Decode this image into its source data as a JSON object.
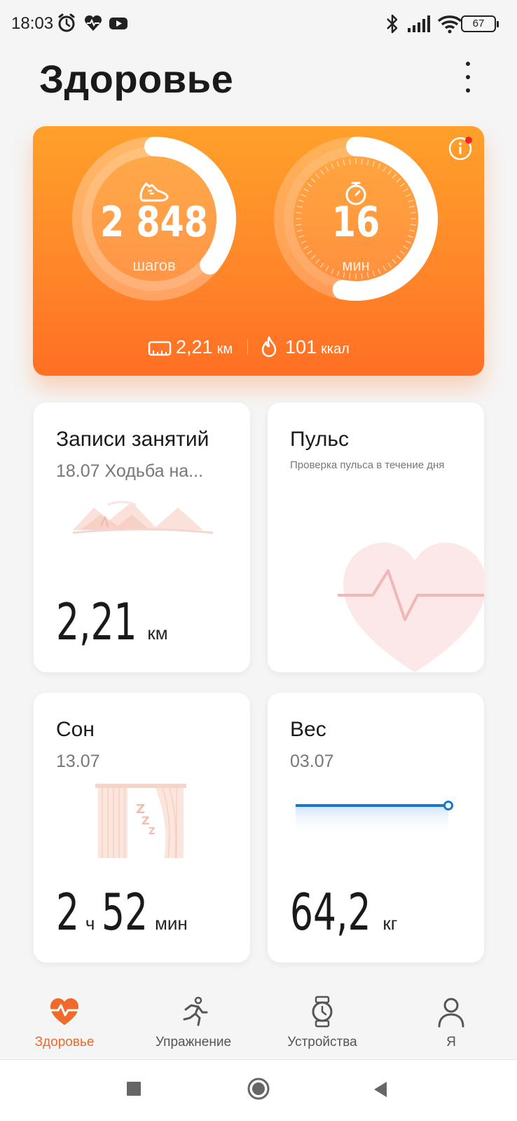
{
  "status_bar": {
    "time": "18:03",
    "left_icons": [
      "alarm-icon",
      "heart-rate-icon",
      "youtube-icon"
    ],
    "right_icons": [
      "bluetooth-icon",
      "signal-icon",
      "wifi-icon"
    ],
    "battery": "67"
  },
  "header": {
    "title": "Здоровье",
    "menu_icon": "more-vertical-icon"
  },
  "activity": {
    "steps_value": "2 848",
    "steps_unit": "шагов",
    "steps_progress": 0.36,
    "minutes_value": "16",
    "minutes_unit": "мин",
    "minutes_progress": 0.53,
    "distance_value": "2,21",
    "distance_unit": "км",
    "calories_value": "101",
    "calories_unit": "ккал",
    "info_has_badge": true,
    "colors": {
      "start": "#ffa02a",
      "end": "#ff6f24"
    }
  },
  "tiles": {
    "workouts": {
      "title": "Записи занятий",
      "subtitle": "18.07 Ходьба на...",
      "value": "2,21",
      "unit": "км"
    },
    "pulse": {
      "title": "Пульс",
      "subtitle": "Проверка пульса в течение дня"
    },
    "sleep": {
      "title": "Сон",
      "date": "13.07",
      "hours": "2",
      "hours_unit": "ч",
      "minutes": "52",
      "minutes_unit": "мин"
    },
    "weight": {
      "title": "Вес",
      "date": "03.07",
      "value": "64,2",
      "unit": "кг",
      "line_color": "#1976d2"
    }
  },
  "bottom_nav": {
    "items": [
      {
        "label": "Здоровье",
        "icon": "heart-pulse-icon",
        "active": true
      },
      {
        "label": "Упражнение",
        "icon": "running-icon",
        "active": false
      },
      {
        "label": "Устройства",
        "icon": "watch-icon",
        "active": false
      },
      {
        "label": "Я",
        "icon": "person-icon",
        "active": false
      }
    ],
    "accent": "#ef6a2b"
  },
  "system_nav": [
    "recents-button",
    "home-button",
    "back-button"
  ]
}
